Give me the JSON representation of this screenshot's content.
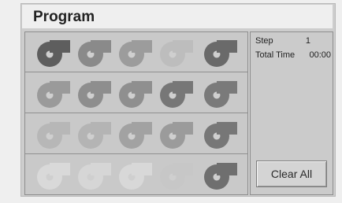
{
  "title": "Program",
  "info": {
    "step_label": "Step",
    "step_value": "1",
    "total_time_label": "Total Time",
    "total_time_value": "00:00"
  },
  "clear_all_label": "Clear All",
  "grid": [
    [
      "#5e5e5e",
      "#8a8a8a",
      "#9c9c9c",
      "#bdbdbd",
      "#6a6a6a"
    ],
    [
      "#9a9a9a",
      "#8e8e8e",
      "#8f8f8f",
      "#777777",
      "#7a7a7a"
    ],
    [
      "#b7b7b7",
      "#b4b4b4",
      "#a2a2a2",
      "#9b9b9b",
      "#777777"
    ],
    [
      "#d9d9d9",
      "#d6d6d6",
      "#d8d8d8",
      "#c7c7c7",
      "#6f6f6f"
    ]
  ],
  "icon_name": "disc-track-icon"
}
